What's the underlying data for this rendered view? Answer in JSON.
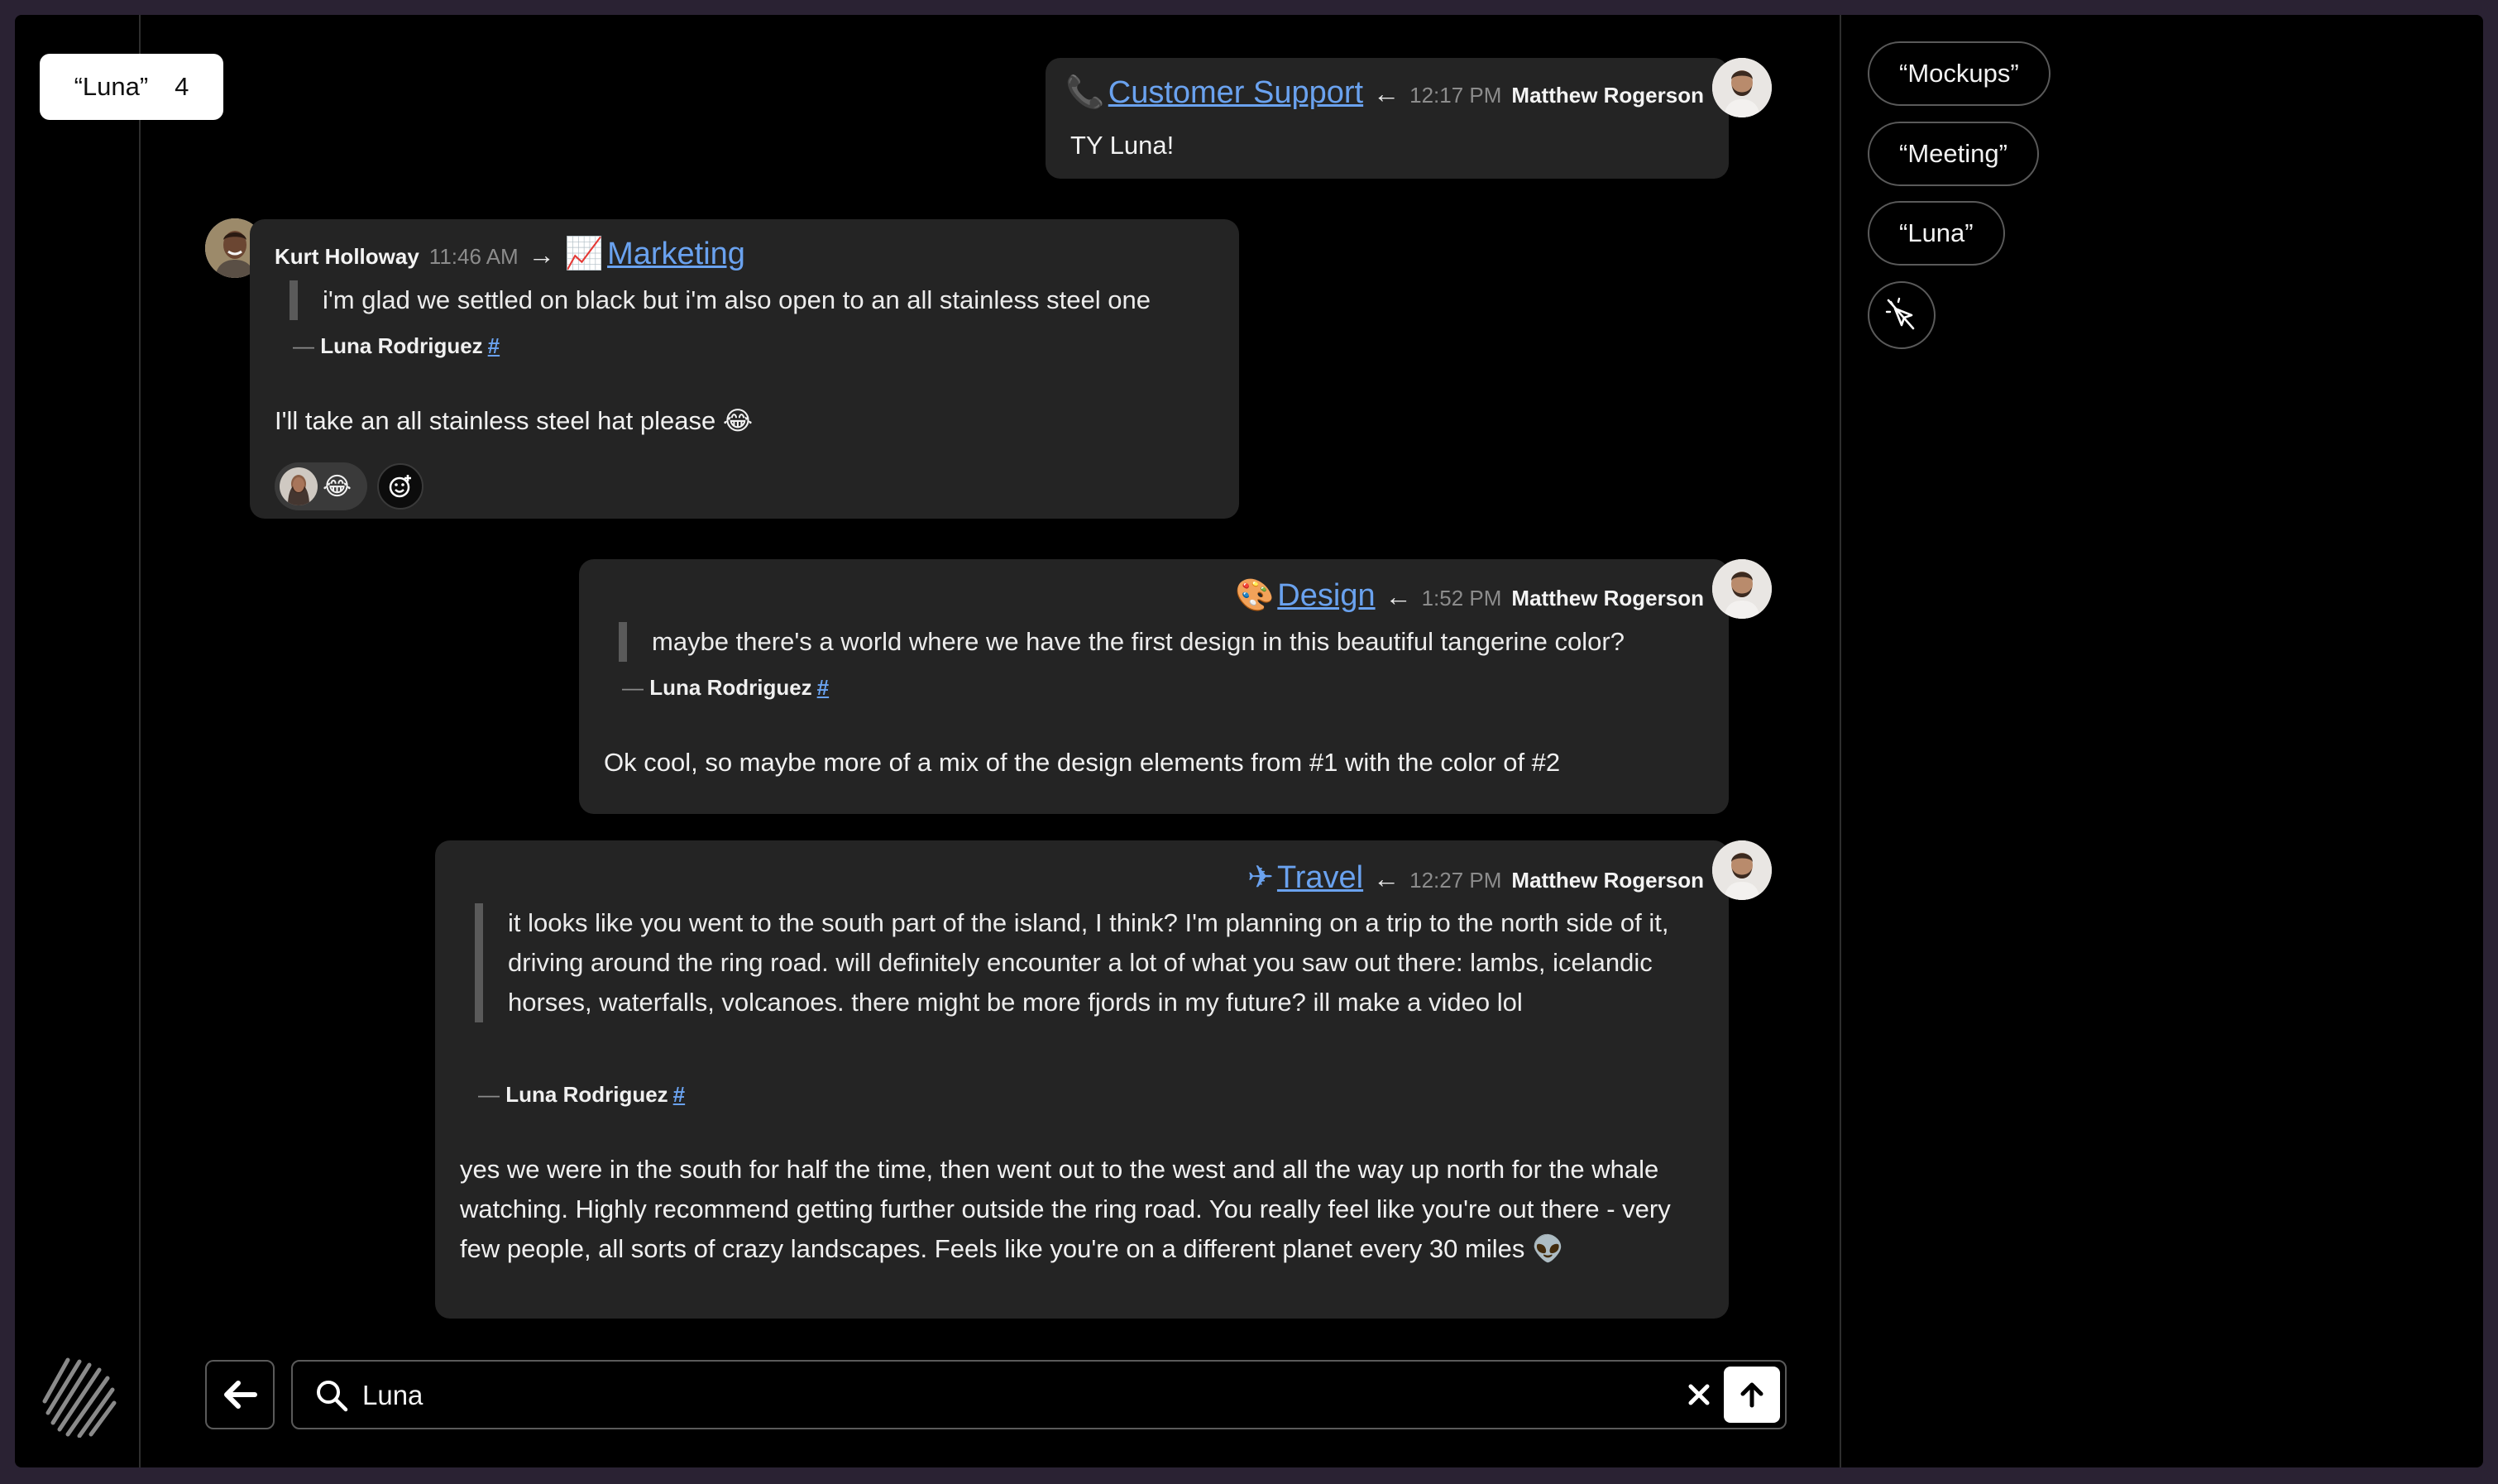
{
  "search_tag": {
    "query": "“Luna”",
    "count": "4"
  },
  "messages": [
    {
      "direction": "outgoing",
      "channel": {
        "emoji": "📞",
        "name": "Customer Support"
      },
      "time": "12:17 PM",
      "author": "Matthew Rogerson",
      "body": "TY Luna!"
    },
    {
      "direction": "incoming",
      "channel": {
        "emoji": "📈",
        "name": "Marketing"
      },
      "time": "11:46 AM",
      "author": "Kurt Holloway",
      "quote": "i'm glad we settled on black but i'm also open to an all stainless steel one",
      "quote_author": "Luna Rodriguez",
      "quote_link": "#",
      "body": "I'll take an all stainless steel hat please 😂",
      "reaction_emoji": "😂"
    },
    {
      "direction": "outgoing",
      "channel": {
        "emoji": "🎨",
        "name": "Design"
      },
      "time": "1:52 PM",
      "author": "Matthew Rogerson",
      "quote": "maybe there's a world where we have the first design in this beautiful tangerine color?",
      "quote_author": "Luna Rodriguez",
      "quote_link": "#",
      "body": "Ok cool, so maybe more of a mix of the design elements from #1 with the color of #2"
    },
    {
      "direction": "outgoing",
      "channel": {
        "emoji": "✈",
        "name": "Travel"
      },
      "time": "12:27 PM",
      "author": "Matthew Rogerson",
      "quote": "it looks like you went to the south part of the island, I think? I'm planning on a trip to the north side of it, driving around the ring road. will definitely encounter a lot of what you saw out there: lambs, icelandic horses, waterfalls, volcanoes. there might be more fjords in my future? ill make a video lol",
      "quote_author": "Luna Rodriguez",
      "quote_link": "#",
      "body": "yes we were in the south for half the time, then went out to the west and all the way up north for the whale watching. Highly recommend getting further outside the ring road. You really feel like you're out there - very few people, all sorts of crazy landscapes. Feels like you're on a different planet every 30 miles 👽"
    }
  ],
  "icons": {
    "arrow_left": "←",
    "arrow_right": "→",
    "attr_dash": "—"
  },
  "recent_searches": [
    "“Mockups”",
    "“Meeting”",
    "“Luna”"
  ],
  "search": {
    "value": "Luna",
    "placeholder": ""
  },
  "colors": {
    "link": "#6aa2ef",
    "bubble": "#242424",
    "background": "#000000"
  }
}
